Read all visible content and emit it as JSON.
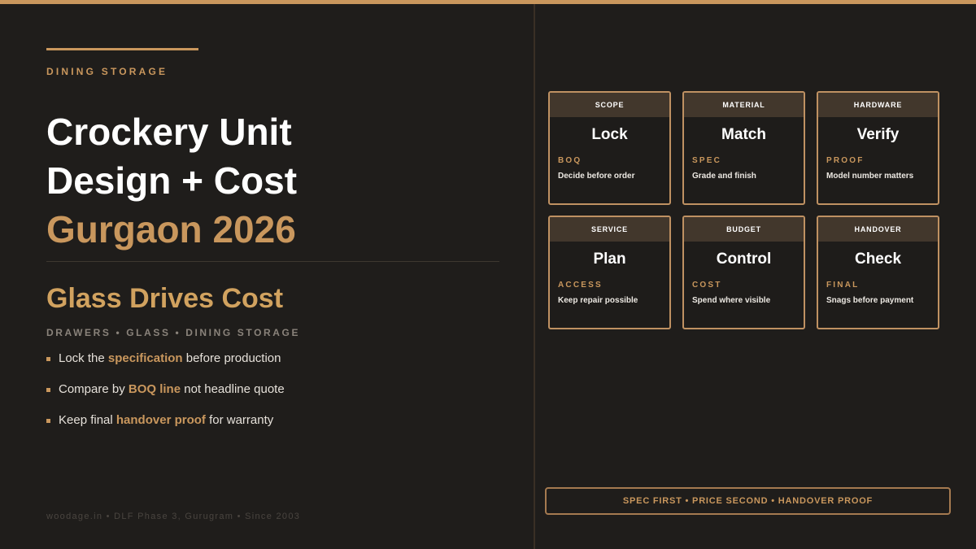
{
  "colors": {
    "accent": "#c9975d",
    "background": "#1f1d1b",
    "card_header": "#42372c"
  },
  "left": {
    "kicker": "DINING STORAGE",
    "title_line1": "Crockery Unit",
    "title_line2": "Design + Cost",
    "title_line3": "Gurgaon 2026",
    "subhead": "Glass Drives Cost",
    "tagline": "DRAWERS • GLASS • DINING STORAGE",
    "bullets": [
      {
        "pre": "Lock the ",
        "em": "specification",
        "post": " before production"
      },
      {
        "pre": "Compare by ",
        "em": "BOQ line",
        "post": " not headline quote"
      },
      {
        "pre": "Keep final ",
        "em": "handover proof",
        "post": " for warranty"
      }
    ],
    "footer": "woodage.in • DLF Phase 3, Gurugram • Since 2003"
  },
  "cards": [
    {
      "head": "SCOPE",
      "big": "Lock",
      "label": "BOQ",
      "desc": "Decide before order"
    },
    {
      "head": "MATERIAL",
      "big": "Match",
      "label": "SPEC",
      "desc": "Grade and finish"
    },
    {
      "head": "HARDWARE",
      "big": "Verify",
      "label": "PROOF",
      "desc": "Model number matters"
    },
    {
      "head": "SERVICE",
      "big": "Plan",
      "label": "ACCESS",
      "desc": "Keep repair possible"
    },
    {
      "head": "BUDGET",
      "big": "Control",
      "label": "COST",
      "desc": "Spend where visible"
    },
    {
      "head": "HANDOVER",
      "big": "Check",
      "label": "FINAL",
      "desc": "Snags before payment"
    }
  ],
  "banner": "SPEC FIRST • PRICE SECOND • HANDOVER PROOF"
}
